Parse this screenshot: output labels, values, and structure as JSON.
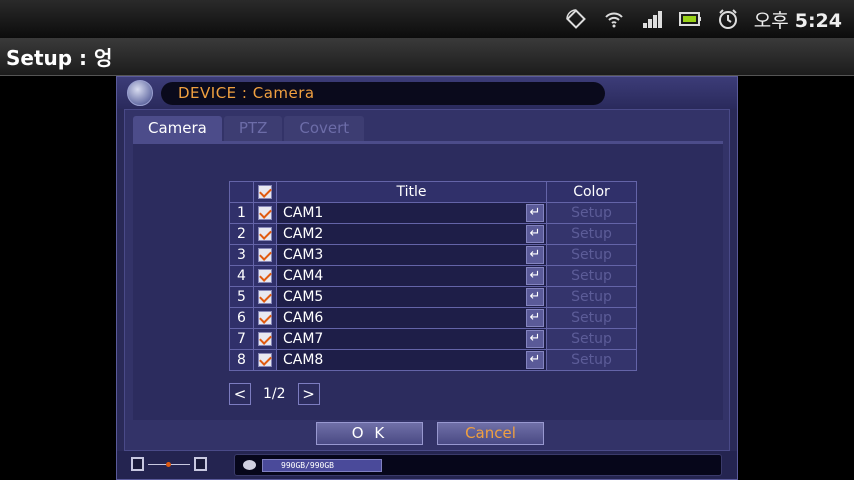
{
  "status_bar": {
    "clock_prefix": "오후",
    "clock_time": "5:24",
    "icons": [
      "rotate-icon",
      "wifi-icon",
      "signal-icon",
      "battery-icon",
      "alarm-icon"
    ]
  },
  "app": {
    "title": "Setup : 엉"
  },
  "dvr": {
    "header_title": "DEVICE : Camera",
    "tabs": [
      {
        "label": "Camera",
        "active": true
      },
      {
        "label": "PTZ",
        "active": false
      },
      {
        "label": "Covert",
        "active": false
      }
    ],
    "table": {
      "headers": {
        "title": "Title",
        "color": "Color"
      },
      "rows": [
        {
          "num": "1",
          "title": "CAM1",
          "color": "Setup",
          "checked": true
        },
        {
          "num": "2",
          "title": "CAM2",
          "color": "Setup",
          "checked": true
        },
        {
          "num": "3",
          "title": "CAM3",
          "color": "Setup",
          "checked": true
        },
        {
          "num": "4",
          "title": "CAM4",
          "color": "Setup",
          "checked": true
        },
        {
          "num": "5",
          "title": "CAM5",
          "color": "Setup",
          "checked": true
        },
        {
          "num": "6",
          "title": "CAM6",
          "color": "Setup",
          "checked": true
        },
        {
          "num": "7",
          "title": "CAM7",
          "color": "Setup",
          "checked": true
        },
        {
          "num": "8",
          "title": "CAM8",
          "color": "Setup",
          "checked": true
        }
      ]
    },
    "pager": {
      "prev": "<",
      "page": "1/2",
      "next": ">"
    },
    "buttons": {
      "ok": "O K",
      "cancel": "Cancel"
    },
    "footer": {
      "hdd": "990GB/990GB"
    }
  },
  "colors": {
    "accent_orange": "#f0a040",
    "panel_bg": "#333368",
    "title_field_bg": "#1e1e48"
  }
}
